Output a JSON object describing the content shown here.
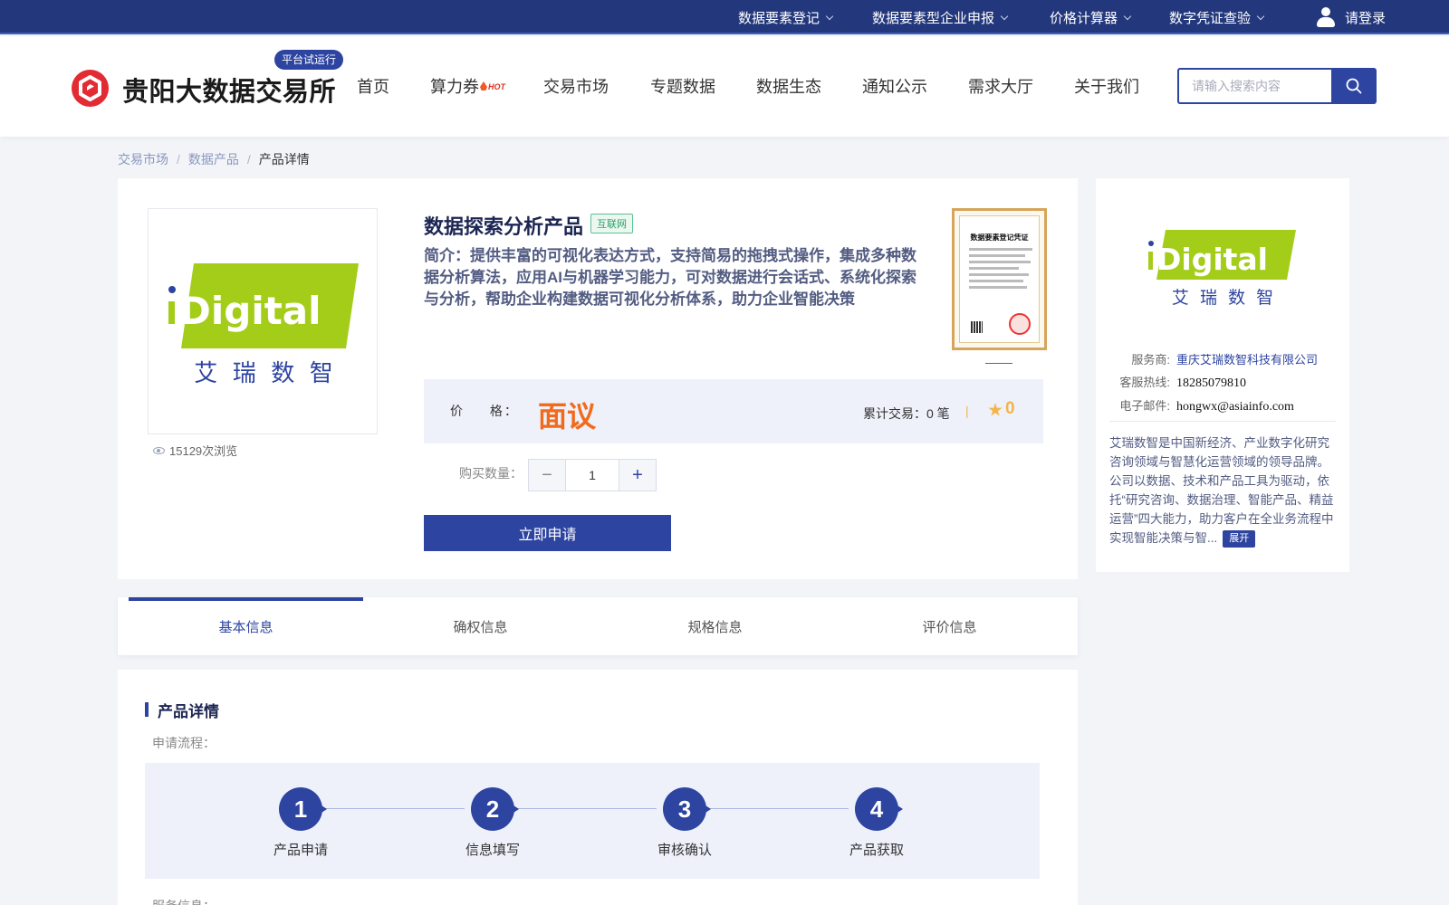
{
  "topbar": {
    "nav": [
      "数据要素登记",
      "数据要素型企业申报",
      "价格计算器",
      "数字凭证查验"
    ],
    "login": "请登录"
  },
  "header": {
    "brand": "贵阳大数据交易所",
    "beta_badge": "平台试运行",
    "nav": [
      "首页",
      "算力券",
      "交易市场",
      "专题数据",
      "数据生态",
      "通知公示",
      "需求大厅",
      "关于我们"
    ],
    "hot_badge": "HOT",
    "search_placeholder": "请输入搜索内容"
  },
  "breadcrumb": [
    "交易市场",
    "数据产品",
    "产品详情"
  ],
  "product": {
    "logo": {
      "word": "Digital",
      "cn": "艾  瑞  数  智"
    },
    "views": "15129次浏览",
    "title": "数据探索分析产品",
    "tag": "互联网",
    "description": "简介：提供丰富的可视化表达方式，支持简易的拖拽式操作，集成多种数据分析算法，应用AI与机器学习能力，可对数据进行会话式、系统化探索与分析，帮助企业构建数据可视化分析体系，助力企业智能决策",
    "certificate_title": "数据要素登记凭证",
    "price_label": "价 格：",
    "price": "面议",
    "trade_count": "累计交易：0 笔",
    "favorites": "0",
    "quantity_label": "购买数量：",
    "quantity": "1",
    "apply_button": "立即申请"
  },
  "tabs": [
    "基本信息",
    "确权信息",
    "规格信息",
    "评价信息"
  ],
  "detail": {
    "section_title": "产品详情",
    "flow_label": "申请流程：",
    "steps": [
      {
        "num": "1",
        "name": "产品申请"
      },
      {
        "num": "2",
        "name": "信息填写"
      },
      {
        "num": "3",
        "name": "审核确认"
      },
      {
        "num": "4",
        "name": "产品获取"
      }
    ],
    "service_label": "服务信息："
  },
  "vendor": {
    "provider_label": "服务商:",
    "provider": "重庆艾瑞数智科技有限公司",
    "hotline_label": "客服热线:",
    "hotline": "18285079810",
    "email_label": "电子邮件:",
    "email": "hongwx@asiainfo.com",
    "description": "艾瑞数智是中国新经济、产业数字化研究咨询领域与智慧化运营领域的领导品牌。公司以数据、技术和产品工具为驱动，依托“研究咨询、数据治理、智能产品、精益运营”四大能力，助力客户在全业务流程中实现智能决策与智...",
    "expand": "展开"
  },
  "colors": {
    "primary": "#2d44a0",
    "topbar": "#23377c",
    "price": "#f26a1b",
    "star": "#f2b54a",
    "logo_green": "#a4cd1a",
    "brand_red": "#e22b32"
  }
}
